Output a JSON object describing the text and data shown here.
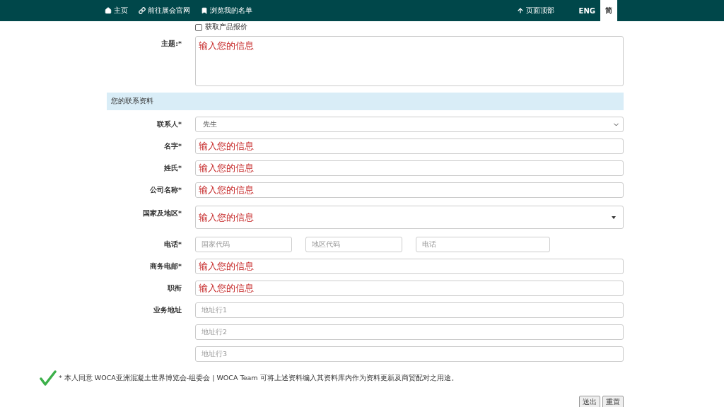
{
  "nav": {
    "left": [
      {
        "label": "主页"
      },
      {
        "label": "前往展会官网"
      },
      {
        "label": "浏览我的名单"
      }
    ],
    "top_link": {
      "label": "页面顶部"
    },
    "languages": [
      {
        "label": "ENG",
        "selected": false
      },
      {
        "label": "简",
        "selected": true
      }
    ]
  },
  "quote_option": {
    "label": "获取产品报价",
    "checked": false
  },
  "subject": {
    "label": "主题:*",
    "value": "输入您的信息"
  },
  "section": {
    "title": "您的联系资料"
  },
  "fields": [
    {
      "kind": "select",
      "label": "联系人*",
      "value": "先生"
    },
    {
      "kind": "input",
      "label": "名字*",
      "value": "输入您的信息"
    },
    {
      "kind": "input",
      "label": "姓氏*",
      "value": "输入您的信息"
    },
    {
      "kind": "input",
      "label": "公司名称*",
      "value": "输入您的信息"
    },
    {
      "kind": "dropdown",
      "label": "国家及地区*",
      "value": "输入您的信息"
    },
    {
      "kind": "phone",
      "label": "电话*",
      "parts": [
        {
          "placeholder": "国家代码"
        },
        {
          "placeholder": "地区代码"
        },
        {
          "placeholder": "电话"
        }
      ]
    },
    {
      "kind": "input",
      "label": "商务电邮*",
      "value": "输入您的信息"
    },
    {
      "kind": "input",
      "label": "职衔",
      "value": "输入您的信息"
    },
    {
      "kind": "address",
      "label": "业务地址",
      "lines": [
        {
          "placeholder": "地址行1"
        },
        {
          "placeholder": "地址行2"
        },
        {
          "placeholder": "地址行3"
        }
      ]
    }
  ],
  "consent": {
    "checked": true,
    "text": "* 本人同意 WOCA亚洲混凝土世界博览会-组委会 | WOCA Team 可将上述资料编入其资料库内作为资料更新及商贸配对之用途。"
  },
  "buttons": [
    {
      "label": "送出"
    },
    {
      "label": "重置"
    }
  ]
}
